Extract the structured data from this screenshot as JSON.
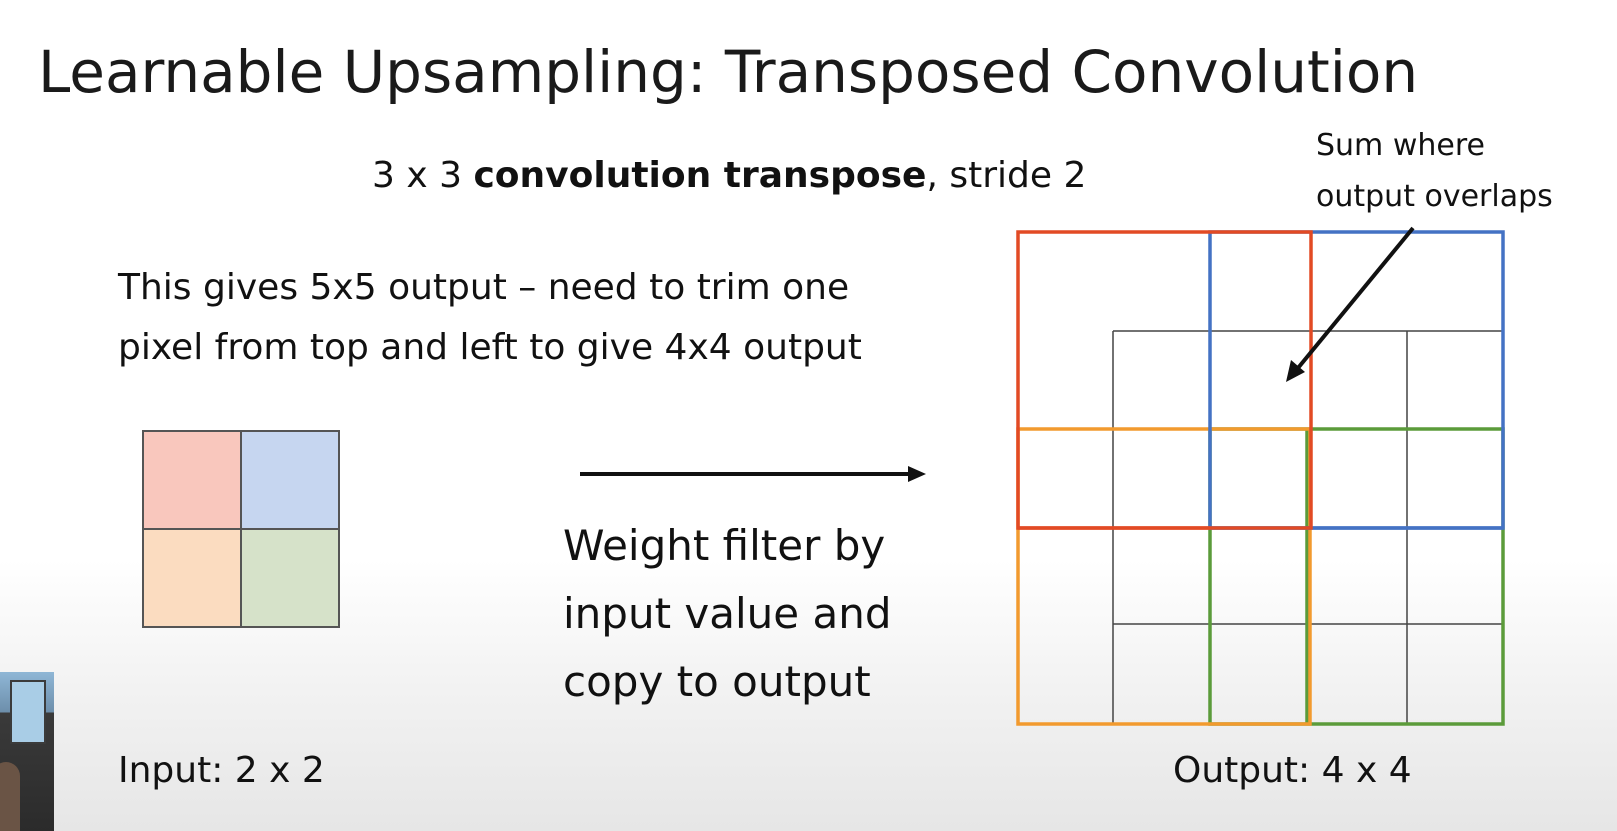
{
  "slide": {
    "title": "Learnable Upsampling: Transposed Convolution",
    "subtitle_prefix": "3 x 3 ",
    "subtitle_bold": "convolution transpose",
    "subtitle_suffix": ", stride 2",
    "note_line1": "This gives 5x5 output – need to trim one",
    "note_line2": "pixel from top and left to give 4x4 output",
    "callout_line1": "Sum where",
    "callout_line2": "output overlaps",
    "process_line1": "Weight filter by",
    "process_line2": "input value and",
    "process_line3": "copy to output",
    "input_label": "Input: 2 x 2",
    "output_label": "Output: 4 x 4"
  },
  "input_grid": {
    "cells": [
      {
        "name": "top-left",
        "color": "#f9c7bd"
      },
      {
        "name": "top-right",
        "color": "#c6d6f0"
      },
      {
        "name": "bottom-left",
        "color": "#fbdcc0"
      },
      {
        "name": "bottom-right",
        "color": "#d6e2c9"
      }
    ]
  },
  "colors": {
    "red": "#e24a24",
    "blue": "#4472c4",
    "orange": "#f29a2e",
    "green": "#5b9b3a",
    "grid": "#444444",
    "arrow": "#111111"
  }
}
